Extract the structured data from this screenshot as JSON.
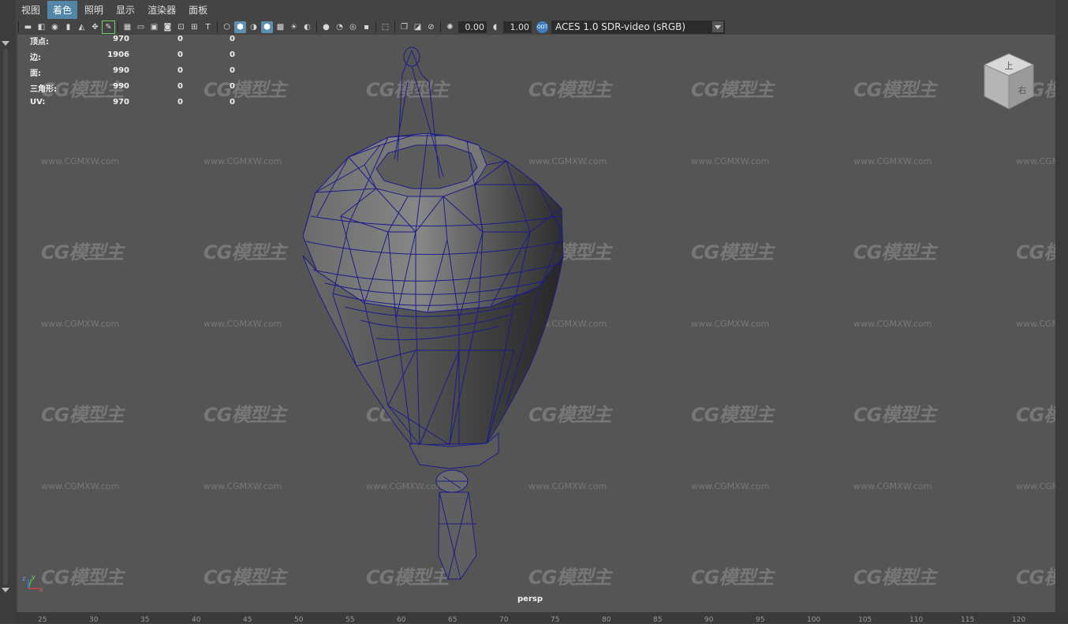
{
  "menu": {
    "items": [
      {
        "label": "视图"
      },
      {
        "label": "着色",
        "active": true
      },
      {
        "label": "照明"
      },
      {
        "label": "显示"
      },
      {
        "label": "渲染器"
      },
      {
        "label": "面板"
      }
    ]
  },
  "toolbar": {
    "exposure_value": "0.00",
    "gamma_value": "1.00",
    "color_space": "ACES 1.0 SDR-video (sRGB)",
    "aces_badge": "ODT"
  },
  "hud": {
    "rows": [
      {
        "label": "顶点:",
        "v1": "970",
        "v2": "0",
        "v3": "0"
      },
      {
        "label": "边:",
        "v1": "1906",
        "v2": "0",
        "v3": "0"
      },
      {
        "label": "面:",
        "v1": "990",
        "v2": "0",
        "v3": "0"
      },
      {
        "label": "三角形:",
        "v1": "990",
        "v2": "0",
        "v3": "0"
      },
      {
        "label": "UV:",
        "v1": "970",
        "v2": "0",
        "v3": "0"
      }
    ]
  },
  "viewport": {
    "camera_label": "persp",
    "watermark_logo": "CG模型主",
    "watermark_url": "www.CGMXW.com",
    "viewcube_faces": {
      "top": "上",
      "right": "右"
    }
  },
  "axis": {
    "x": "x",
    "y": "y",
    "z": "z"
  },
  "ruler": {
    "ticks": [
      "25",
      "30",
      "35",
      "40",
      "45",
      "50",
      "55",
      "60",
      "65",
      "70",
      "75",
      "80",
      "85",
      "90",
      "95",
      "100",
      "105",
      "110",
      "115",
      "120"
    ]
  },
  "colors": {
    "viewport_bg": "#555555",
    "wireframe": "#1c1c8a",
    "menu_active": "#5285a6"
  }
}
